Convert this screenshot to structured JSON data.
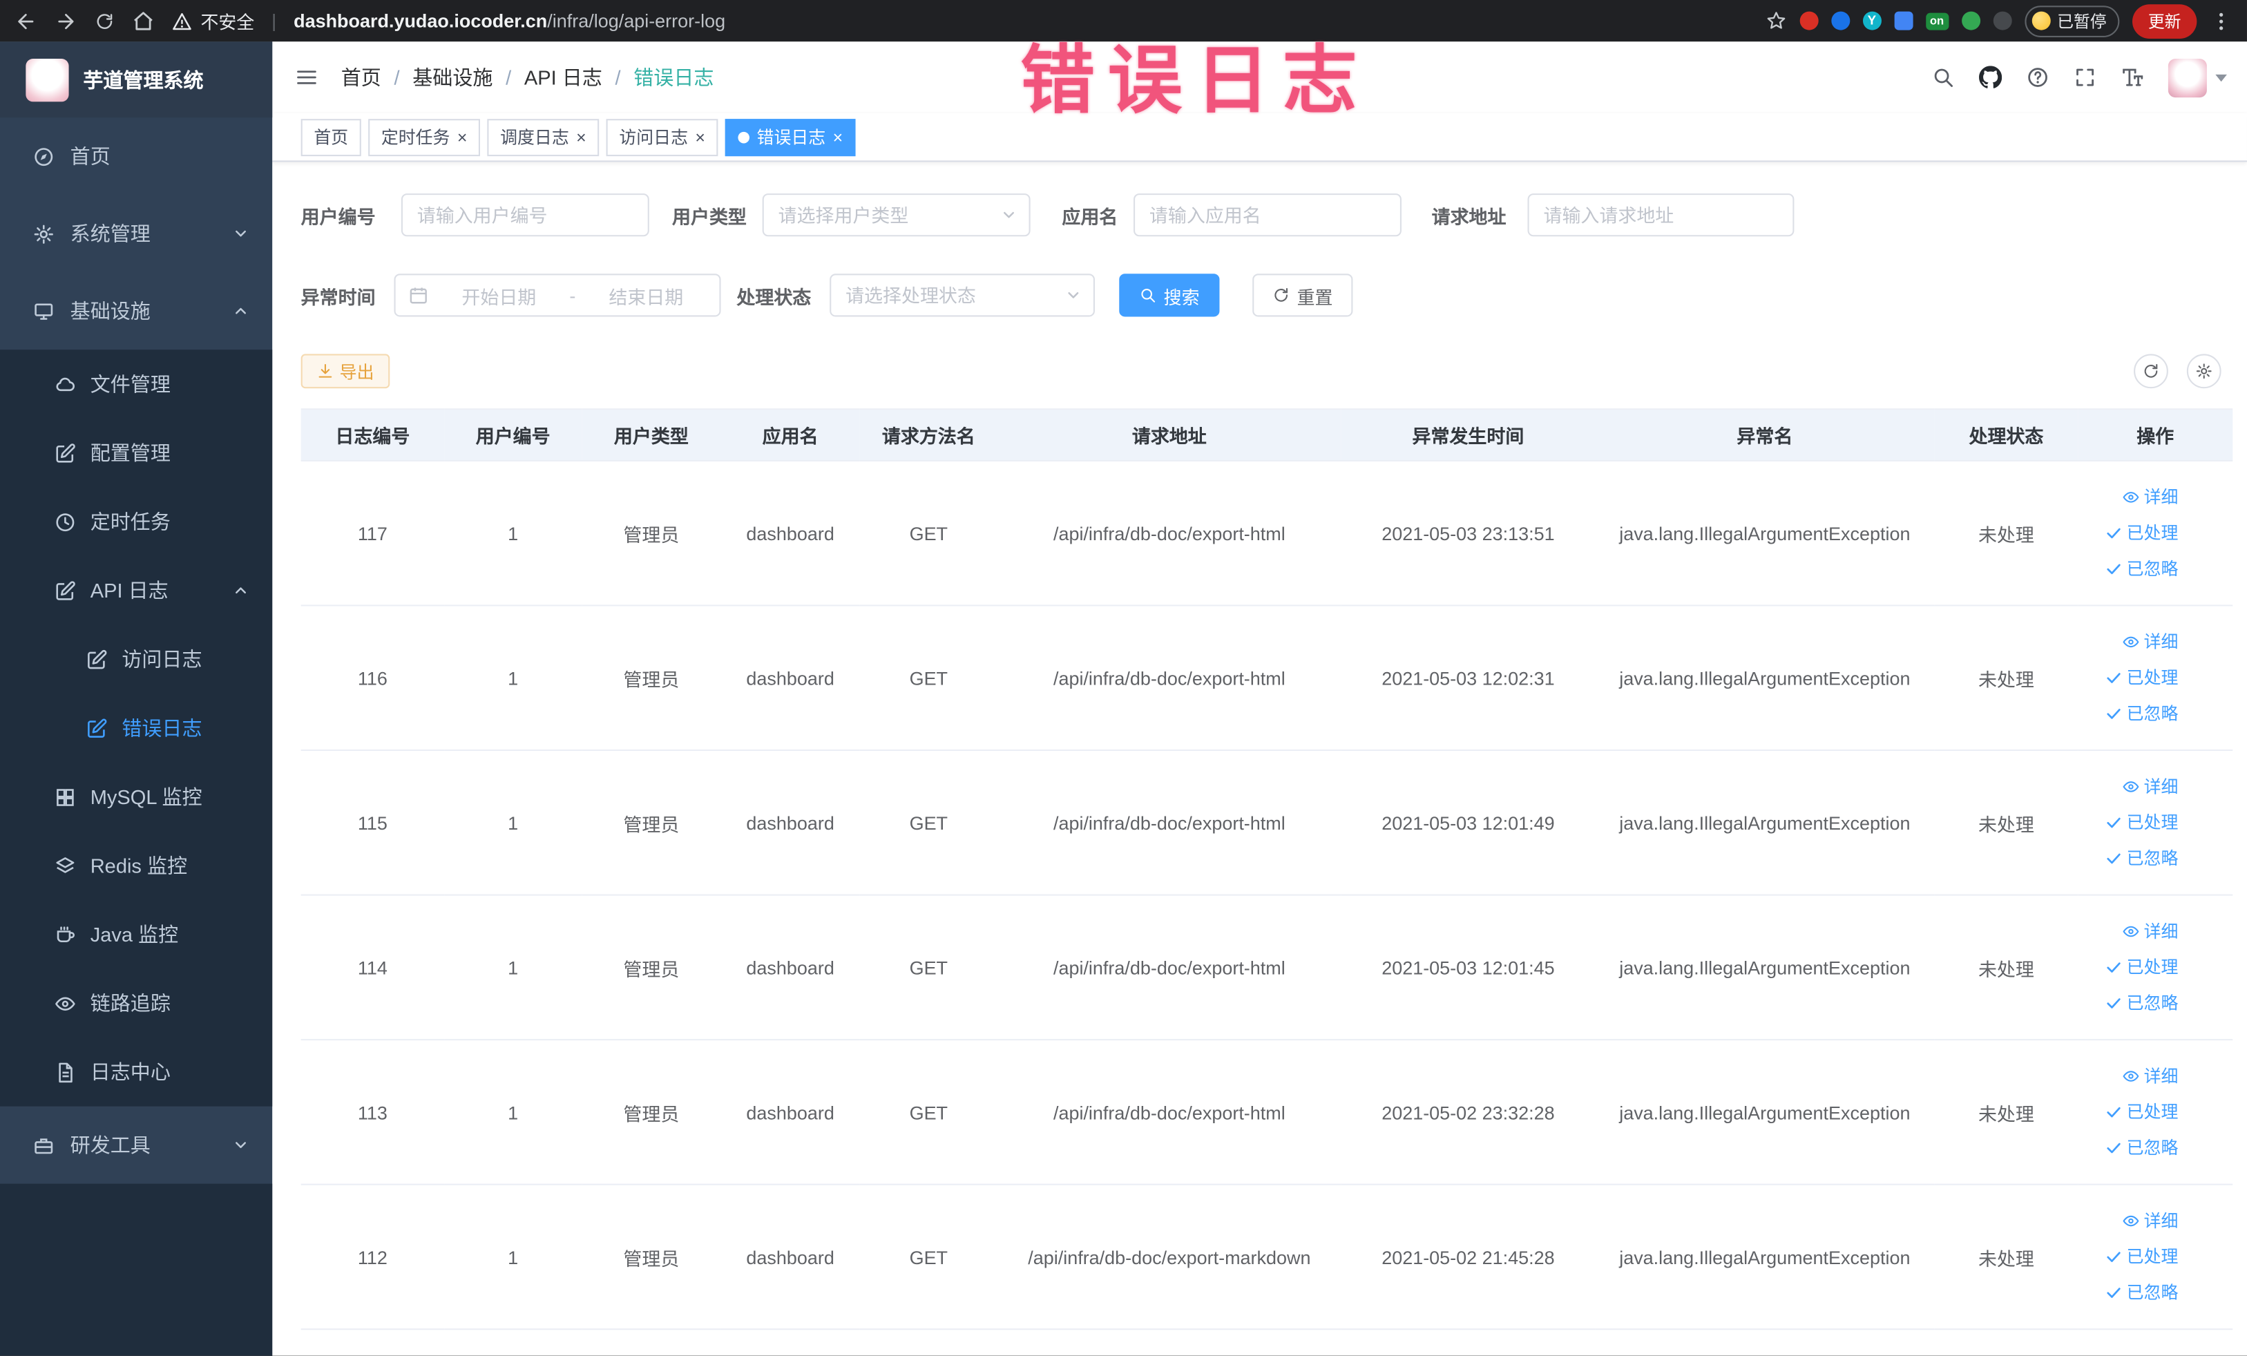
{
  "theme": {
    "accent": "#409eff",
    "warning": "#e6a23c",
    "sidebar_bg": "#304156",
    "submenu_bg": "#1f2d3d",
    "danger_red": "#c5221f",
    "annotation_pink": "#f1547c"
  },
  "browser": {
    "security_label": "不安全",
    "url_domain": "dashboard.yudao.iocoder.cn",
    "url_path": "/infra/log/api-error-log",
    "extension_on_badge": "on",
    "paused_label": "已暂停",
    "update_label": "更新"
  },
  "annotation": {
    "text": "错误日志"
  },
  "sidebar": {
    "logo_title": "芋道管理系统",
    "items": [
      {
        "label": "首页",
        "icon": "compass-icon"
      },
      {
        "label": "系统管理",
        "icon": "gear-icon",
        "state": "collapsed"
      },
      {
        "label": "基础设施",
        "icon": "monitor-icon",
        "state": "expanded"
      },
      {
        "label": "文件管理",
        "icon": "cloud-icon"
      },
      {
        "label": "配置管理",
        "icon": "edit-square-icon"
      },
      {
        "label": "定时任务",
        "icon": "clock-icon"
      },
      {
        "label": "API 日志",
        "icon": "edit-square-icon",
        "state": "expanded"
      },
      {
        "label": "访问日志",
        "icon": "edit-square-icon"
      },
      {
        "label": "错误日志",
        "icon": "edit-square-icon",
        "active": true
      },
      {
        "label": "MySQL 监控",
        "icon": "grid-icon"
      },
      {
        "label": "Redis 监控",
        "icon": "layers-icon"
      },
      {
        "label": "Java 监控",
        "icon": "coffee-icon"
      },
      {
        "label": "链路追踪",
        "icon": "eye-icon"
      },
      {
        "label": "日志中心",
        "icon": "document-icon"
      },
      {
        "label": "研发工具",
        "icon": "briefcase-icon",
        "state": "collapsed"
      }
    ]
  },
  "navbar": {
    "breadcrumb": [
      "首页",
      "基础设施",
      "API 日志",
      "错误日志"
    ],
    "separator": "/"
  },
  "tabs": [
    {
      "label": "首页",
      "closable": false,
      "active": false
    },
    {
      "label": "定时任务",
      "closable": true,
      "active": false
    },
    {
      "label": "调度日志",
      "closable": true,
      "active": false
    },
    {
      "label": "访问日志",
      "closable": true,
      "active": false
    },
    {
      "label": "错误日志",
      "closable": true,
      "active": true
    }
  ],
  "filters": {
    "user_id": {
      "label": "用户编号",
      "placeholder": "请输入用户编号",
      "value": ""
    },
    "user_type": {
      "label": "用户类型",
      "placeholder": "请选择用户类型",
      "value": ""
    },
    "app_name": {
      "label": "应用名",
      "placeholder": "请输入应用名",
      "value": ""
    },
    "request_url": {
      "label": "请求地址",
      "placeholder": "请输入请求地址",
      "value": ""
    },
    "exception_time": {
      "label": "异常时间",
      "start_placeholder": "开始日期",
      "separator": "-",
      "end_placeholder": "结束日期"
    },
    "process_status": {
      "label": "处理状态",
      "placeholder": "请选择处理状态",
      "value": ""
    },
    "search_label": "搜索",
    "reset_label": "重置"
  },
  "toolbar": {
    "export_label": "导出"
  },
  "table": {
    "headers": [
      "日志编号",
      "用户编号",
      "用户类型",
      "应用名",
      "请求方法名",
      "请求地址",
      "异常发生时间",
      "异常名",
      "处理状态",
      "操作"
    ],
    "action_labels": {
      "detail": "详细",
      "processed": "已处理",
      "ignored": "已忽略"
    },
    "rows": [
      {
        "id": "117",
        "user_id": "1",
        "user_type": "管理员",
        "app": "dashboard",
        "method": "GET",
        "url": "/api/infra/db-doc/export-html",
        "time": "2021-05-03 23:13:51",
        "exception": "java.lang.IllegalArgumentException",
        "status": "未处理"
      },
      {
        "id": "116",
        "user_id": "1",
        "user_type": "管理员",
        "app": "dashboard",
        "method": "GET",
        "url": "/api/infra/db-doc/export-html",
        "time": "2021-05-03 12:02:31",
        "exception": "java.lang.IllegalArgumentException",
        "status": "未处理"
      },
      {
        "id": "115",
        "user_id": "1",
        "user_type": "管理员",
        "app": "dashboard",
        "method": "GET",
        "url": "/api/infra/db-doc/export-html",
        "time": "2021-05-03 12:01:49",
        "exception": "java.lang.IllegalArgumentException",
        "status": "未处理"
      },
      {
        "id": "114",
        "user_id": "1",
        "user_type": "管理员",
        "app": "dashboard",
        "method": "GET",
        "url": "/api/infra/db-doc/export-html",
        "time": "2021-05-03 12:01:45",
        "exception": "java.lang.IllegalArgumentException",
        "status": "未处理"
      },
      {
        "id": "113",
        "user_id": "1",
        "user_type": "管理员",
        "app": "dashboard",
        "method": "GET",
        "url": "/api/infra/db-doc/export-html",
        "time": "2021-05-02 23:32:28",
        "exception": "java.lang.IllegalArgumentException",
        "status": "未处理"
      },
      {
        "id": "112",
        "user_id": "1",
        "user_type": "管理员",
        "app": "dashboard",
        "method": "GET",
        "url": "/api/infra/db-doc/export-markdown",
        "time": "2021-05-02 21:45:28",
        "exception": "java.lang.IllegalArgumentException",
        "status": "未处理"
      }
    ]
  }
}
